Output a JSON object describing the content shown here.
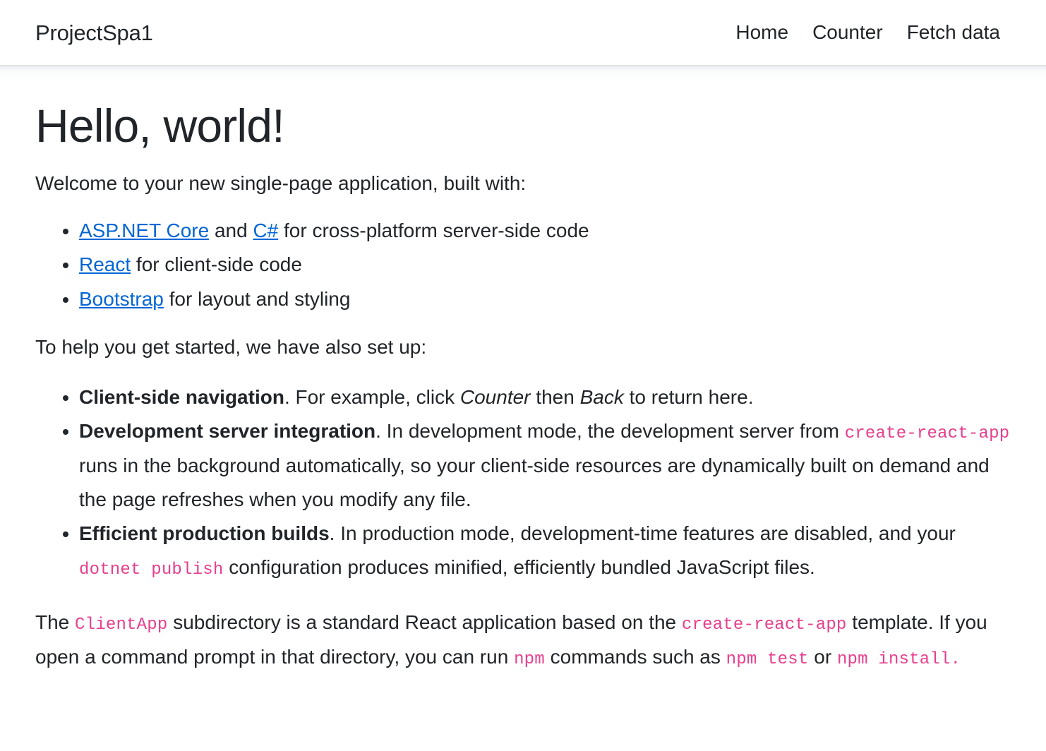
{
  "navbar": {
    "brand": "ProjectSpa1",
    "links": [
      {
        "label": "Home",
        "name": "nav-link-home"
      },
      {
        "label": "Counter",
        "name": "nav-link-counter"
      },
      {
        "label": "Fetch data",
        "name": "nav-link-fetch-data"
      }
    ]
  },
  "main": {
    "title": "Hello, world!",
    "intro": "Welcome to your new single-page application, built with:",
    "built_with": {
      "item1": {
        "link1": "ASP.NET Core",
        "mid": " and ",
        "link2": "C#",
        "tail": " for cross-platform server-side code"
      },
      "item2": {
        "link": "React",
        "tail": " for client-side code"
      },
      "item3": {
        "link": "Bootstrap",
        "tail": " for layout and styling"
      }
    },
    "setup_intro": "To help you get started, we have also set up:",
    "setup": {
      "item1": {
        "term": "Client-side navigation",
        "part1": ". For example, click ",
        "em1": "Counter",
        "part2": " then ",
        "em2": "Back",
        "part3": " to return here."
      },
      "item2": {
        "term": "Development server integration",
        "part1": ". In development mode, the development server from ",
        "code1": "create-react-app",
        "part2": " runs in the background automatically, so your client-side resources are dynamically built on demand and the page refreshes when you modify any file."
      },
      "item3": {
        "term": "Efficient production builds",
        "part1": ". In production mode, development-time features are disabled, and your ",
        "code1": "dotnet publish",
        "part2": " configuration produces minified, efficiently bundled JavaScript files."
      }
    },
    "closing": {
      "part1": "The ",
      "code1": "ClientApp",
      "part2": " subdirectory is a standard React application based on the ",
      "code2": "create-react-app",
      "part3": " template. If you open a command prompt in that directory, you can run ",
      "code3": "npm",
      "part4": " commands such as ",
      "code4": "npm test",
      "part5": " or ",
      "code5": "npm install",
      "part6": "."
    }
  },
  "colors": {
    "link": "#0366d6",
    "code": "#e83e8c",
    "text": "#212529",
    "navbar_border": "#dee2e6",
    "background": "#ffffff"
  }
}
